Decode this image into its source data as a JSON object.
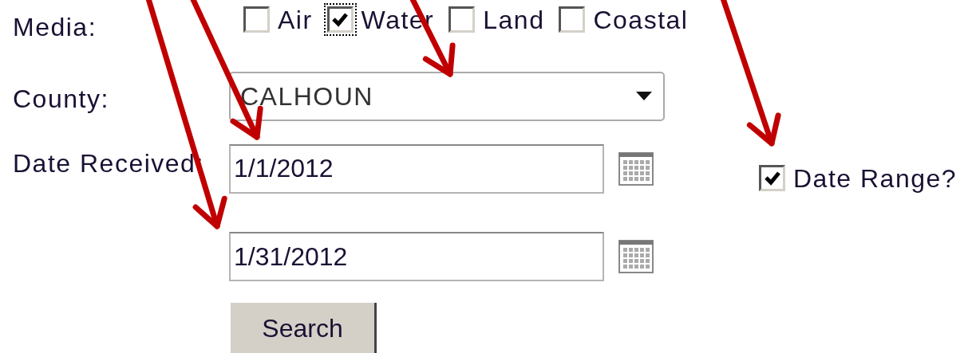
{
  "media": {
    "label": "Media:",
    "options": [
      {
        "label": "Air",
        "checked": false,
        "focused": false
      },
      {
        "label": "Water",
        "checked": true,
        "focused": true
      },
      {
        "label": "Land",
        "checked": false,
        "focused": false
      },
      {
        "label": "Coastal",
        "checked": false,
        "focused": false
      }
    ]
  },
  "county": {
    "label": "County:",
    "value": "CALHOUN"
  },
  "date_received": {
    "label": "Date Received:",
    "start": "1/1/2012",
    "end": "1/31/2012"
  },
  "date_range": {
    "label": "Date Range?",
    "checked": true
  },
  "search_button": "Search"
}
